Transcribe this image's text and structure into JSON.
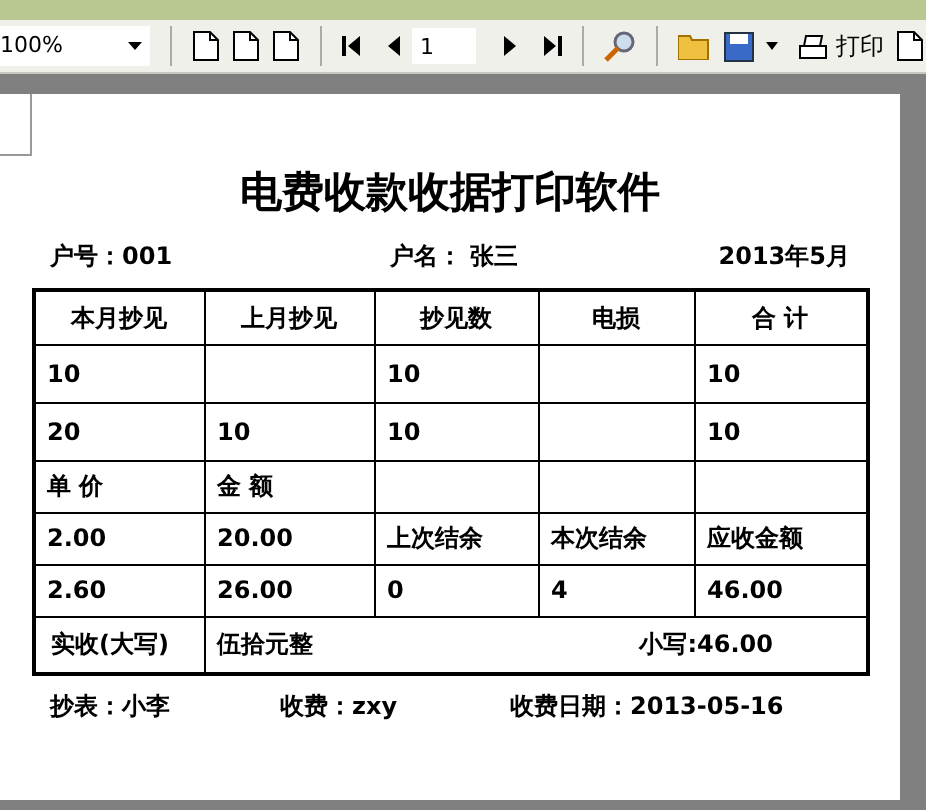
{
  "toolbar": {
    "zoom": "100%",
    "page": "1",
    "print_label": "打印"
  },
  "receipt": {
    "title": "电费收款收据打印软件",
    "meta": [
      "户号：001",
      "户名：  张三",
      "2013年5月"
    ],
    "columns": [
      "本月抄见",
      "上月抄见",
      "抄见数",
      "电损",
      "合 计"
    ],
    "rows": [
      [
        "10",
        null,
        "10",
        null,
        "10"
      ],
      [
        "20",
        "10",
        "10",
        null,
        "10"
      ],
      [
        "单 价",
        "金 额",
        null,
        null,
        null
      ],
      [
        "2.00",
        "20.00",
        "上次结余",
        "本次结余",
        "应收金额"
      ],
      [
        "2.60",
        "26.00",
        "0",
        "4",
        "46.00"
      ]
    ],
    "paid_label": "实收(大写)",
    "amount_words": "伍拾元整",
    "amount_small": "小写:46.00",
    "footer": [
      "抄表：小李",
      "收费：zxy",
      "收费日期：2013-05-16"
    ]
  }
}
